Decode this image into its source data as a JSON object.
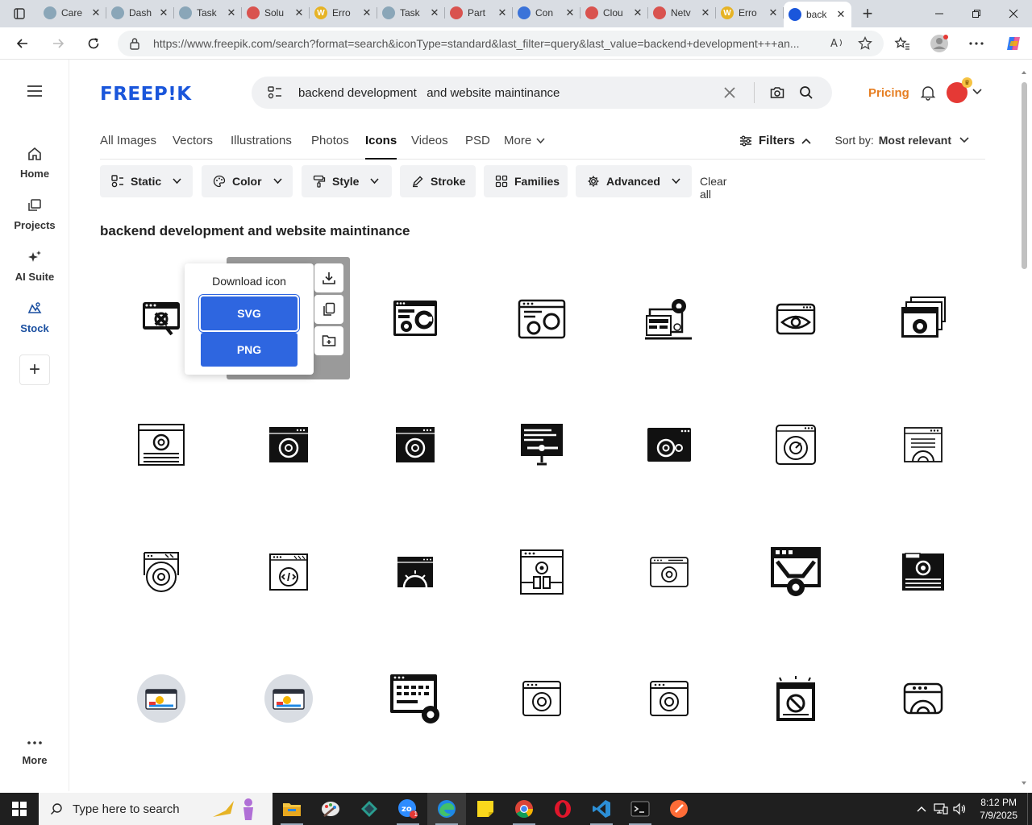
{
  "browser": {
    "tabs": [
      {
        "title": "Care",
        "color": "#8aa6b8",
        "letter": ""
      },
      {
        "title": "Dash",
        "color": "#8aa6b8",
        "letter": ""
      },
      {
        "title": "Task",
        "color": "#8aa6b8",
        "letter": ""
      },
      {
        "title": "Solu",
        "color": "#d9534f",
        "letter": ""
      },
      {
        "title": "Erro",
        "color": "#e6b325",
        "letter": "W"
      },
      {
        "title": "Task",
        "color": "#8aa6b8",
        "letter": ""
      },
      {
        "title": "Part",
        "color": "#d9534f",
        "letter": ""
      },
      {
        "title": "Con",
        "color": "#3b73d9",
        "letter": ""
      },
      {
        "title": "Clou",
        "color": "#d9534f",
        "letter": ""
      },
      {
        "title": "Netv",
        "color": "#d9534f",
        "letter": ""
      },
      {
        "title": "Erro",
        "color": "#e6b325",
        "letter": "W"
      },
      {
        "title": "back",
        "color": "#1a56db",
        "letter": ""
      }
    ],
    "url": "https://www.freepik.com/search?format=search&iconType=standard&last_filter=query&last_value=backend+development+++an..."
  },
  "rail": {
    "home": "Home",
    "projects": "Projects",
    "ai_suite": "AI Suite",
    "stock": "Stock",
    "more": "More"
  },
  "header": {
    "logo": "FREEP!K",
    "search_value": "backend development   and website maintinance",
    "pricing": "Pricing"
  },
  "type_tabs": [
    "All Images",
    "Vectors",
    "Illustrations",
    "Photos",
    "Icons",
    "Videos",
    "PSD",
    "More"
  ],
  "active_type_tab": "Icons",
  "filters_label": "Filters",
  "sort": {
    "label": "Sort by:",
    "value": "Most relevant"
  },
  "chips": [
    "Static",
    "Color",
    "Style",
    "Stroke",
    "Families",
    "Advanced"
  ],
  "clear_all": "Clear all",
  "results_heading": "backend development and website maintinance",
  "download_popup": {
    "title": "Download icon",
    "svg": "SVG",
    "png": "PNG"
  },
  "taskbar": {
    "search_placeholder": "Type here to search",
    "time": "8:12 PM",
    "date": "7/9/2025",
    "zoom_badge": "1"
  },
  "colors": {
    "brand": "#1a56db",
    "pricing": "#e67e22",
    "download_button": "#2e66e0"
  }
}
